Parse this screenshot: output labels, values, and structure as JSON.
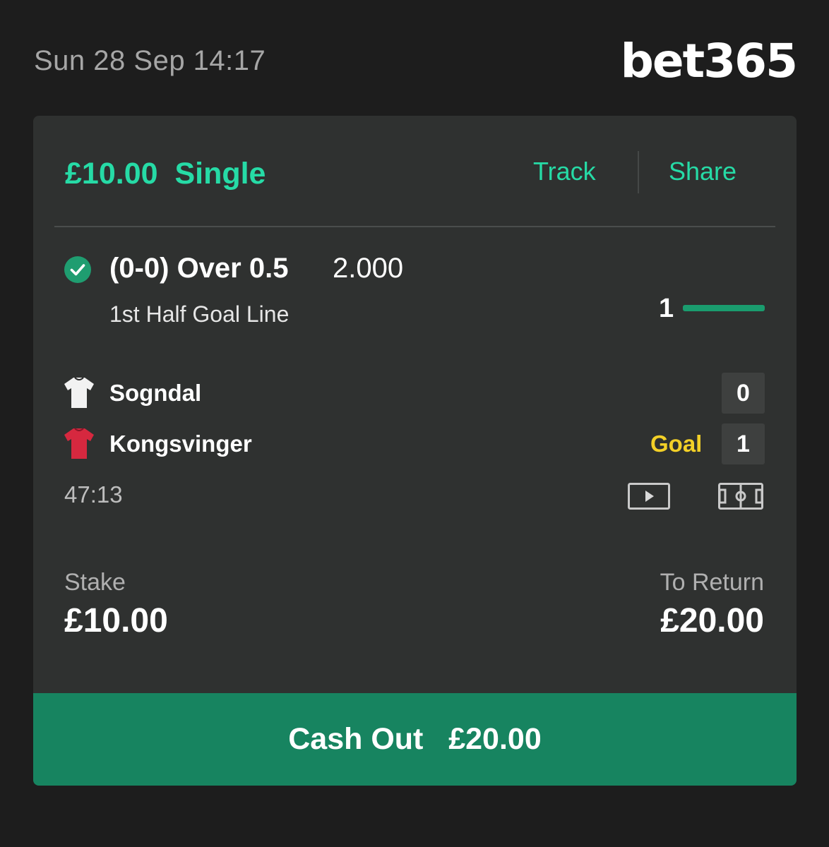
{
  "header": {
    "datetime": "Sun 28 Sep 14:17",
    "logo_text": "bet365"
  },
  "bet": {
    "stake_display": "£10.00",
    "bet_type": "Single",
    "track_label": "Track",
    "share_label": "Share",
    "status": "won",
    "selection": "(0-0) Over 0.5",
    "odds": "2.000",
    "market": "1st Half Goal Line",
    "goal_line_count": "1",
    "goal_line_progress": 1.0
  },
  "match": {
    "home": {
      "name": "Sogndal",
      "score": "0",
      "kit_color": "#f2f2f2"
    },
    "away": {
      "name": "Kongsvinger",
      "score": "1",
      "kit_color": "#d6283f",
      "event": "Goal"
    },
    "clock": "47:13"
  },
  "summary": {
    "stake_label": "Stake",
    "stake_value": "£10.00",
    "return_label": "To Return",
    "return_value": "£20.00"
  },
  "cashout": {
    "label": "Cash Out",
    "amount": "£20.00"
  },
  "colors": {
    "accent": "#26dba6",
    "cashout_bg": "#178460",
    "goal_text": "#f3d027",
    "card_bg": "#2f3130"
  },
  "icons": {
    "status": "check-circle-icon",
    "video": "play-video-icon",
    "pitch": "pitch-tracker-icon"
  }
}
